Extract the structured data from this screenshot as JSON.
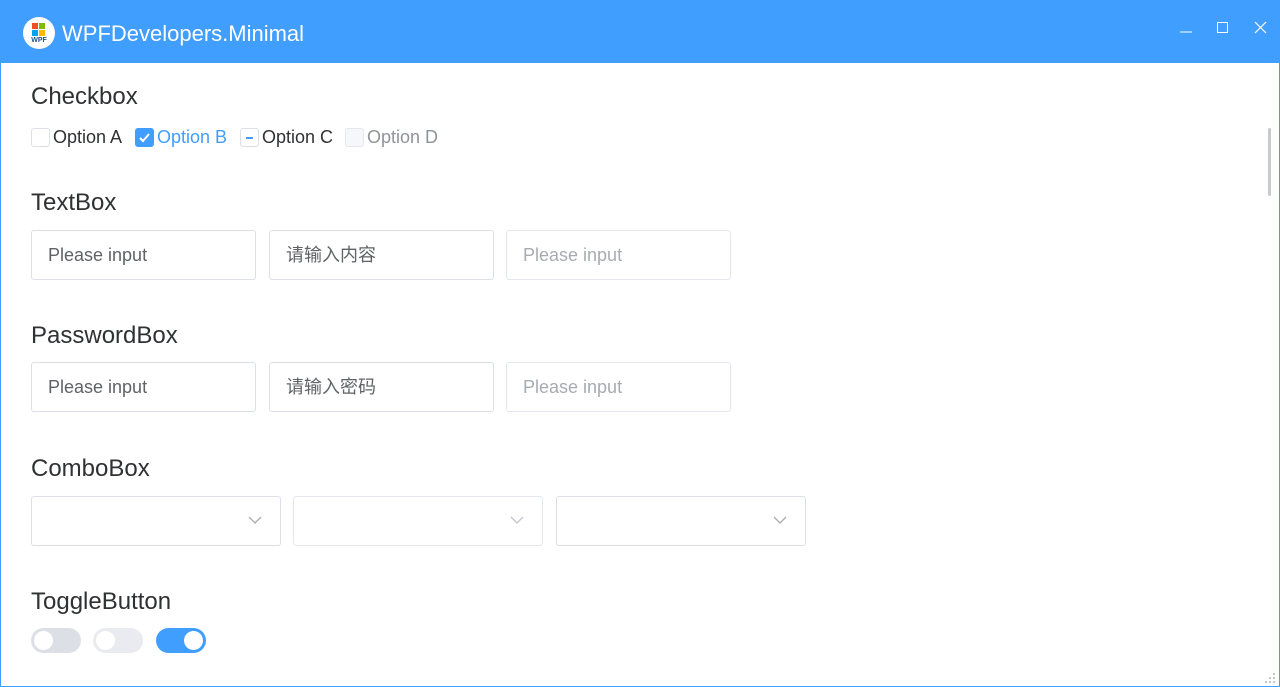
{
  "window": {
    "title": "WPFDevelopers.Minimal",
    "logo_text": "WPF",
    "accent_color": "#409eff",
    "controls": [
      "minimize-icon",
      "maximize-icon",
      "close-icon"
    ]
  },
  "checkbox": {
    "title": "Checkbox",
    "options": [
      {
        "label": "Option A",
        "state": "unchecked"
      },
      {
        "label": "Option B",
        "state": "checked"
      },
      {
        "label": "Option C",
        "state": "indeterminate"
      },
      {
        "label": "Option D",
        "state": "disabled"
      }
    ]
  },
  "textbox": {
    "title": "TextBox",
    "fields": [
      {
        "placeholder": "Please input",
        "state": "normal"
      },
      {
        "placeholder": "请输入内容",
        "state": "normal"
      },
      {
        "placeholder": "Please input",
        "state": "disabled"
      }
    ]
  },
  "passwordbox": {
    "title": "PasswordBox",
    "fields": [
      {
        "placeholder": "Please input",
        "state": "normal"
      },
      {
        "placeholder": "请输入密码",
        "state": "normal"
      },
      {
        "placeholder": "Please input",
        "state": "disabled"
      }
    ]
  },
  "combobox": {
    "title": "ComboBox",
    "boxes": [
      {
        "value": "",
        "state": "normal"
      },
      {
        "value": "",
        "state": "disabled"
      },
      {
        "value": "",
        "state": "normal"
      }
    ]
  },
  "togglebutton": {
    "title": "ToggleButton",
    "toggles": [
      {
        "state": "off"
      },
      {
        "state": "off-disabled"
      },
      {
        "state": "on"
      }
    ]
  }
}
